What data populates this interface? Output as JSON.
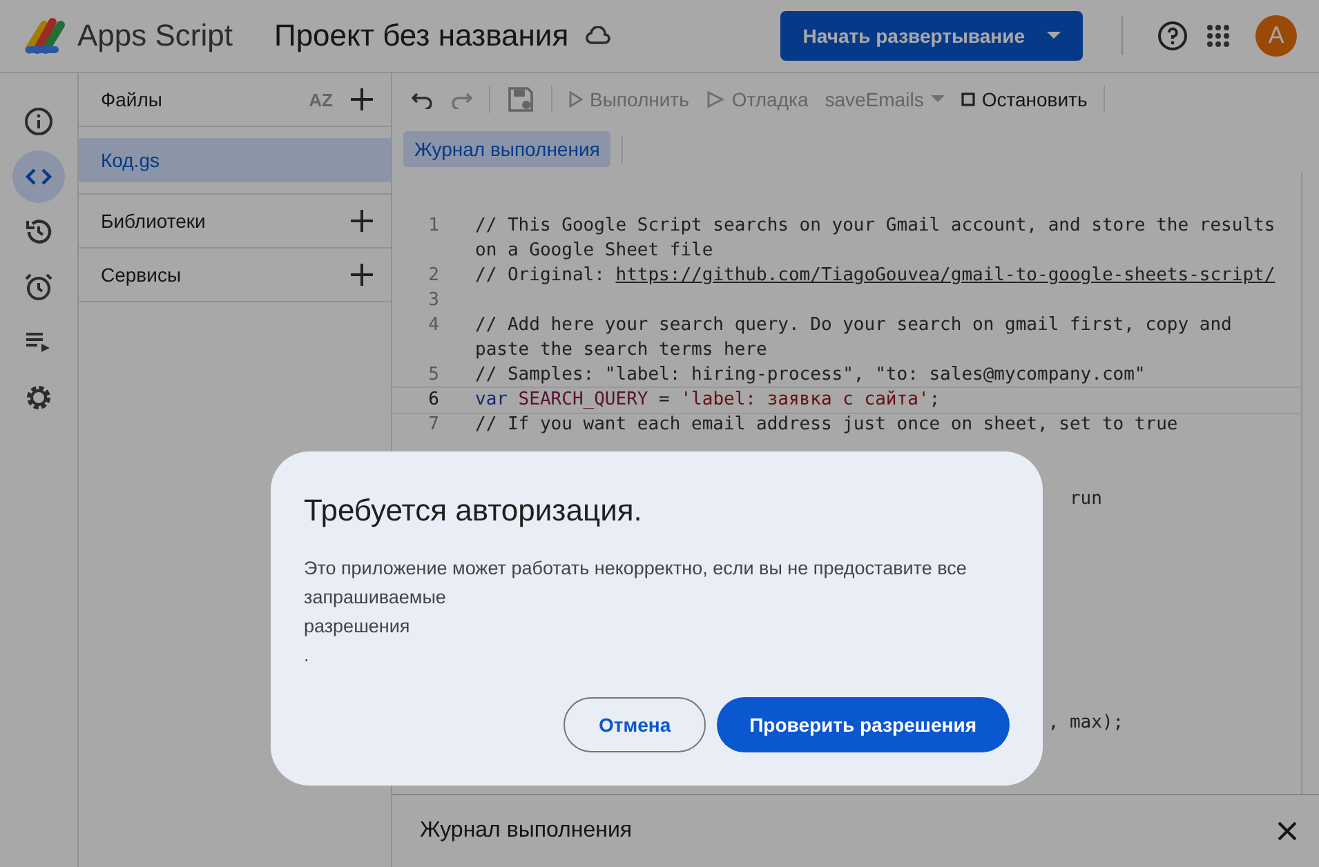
{
  "header": {
    "app_name": "Apps Script",
    "project_title": "Проект без названия",
    "deploy_button": "Начать развертывание",
    "avatar_letter": "A"
  },
  "rail": [
    {
      "selected": false
    },
    {
      "selected": true
    },
    {
      "selected": false
    },
    {
      "selected": false
    },
    {
      "selected": false
    },
    {
      "selected": false
    }
  ],
  "files_panel": {
    "sections": [
      {
        "title": "Файлы",
        "sort_label": "AZ",
        "items": [
          {
            "label": "Код.gs",
            "selected": true
          }
        ]
      },
      {
        "title": "Библиотеки"
      },
      {
        "title": "Сервисы"
      }
    ]
  },
  "toolbar": {
    "run": "Выполнить",
    "debug": "Отладка",
    "function": "saveEmails",
    "stop": "Остановить"
  },
  "tabs": [
    {
      "label": "Журнал выполнения",
      "selected": true
    }
  ],
  "code": [
    {
      "number": "1",
      "current": false,
      "segments": [
        {
          "kind": "comment",
          "text": "// This Google Script searchs on your Gmail account, and store the results on a Google Sheet file"
        }
      ]
    },
    {
      "number": "2",
      "current": false,
      "segments": [
        {
          "kind": "comment",
          "text": "// Original: "
        },
        {
          "kind": "link",
          "text": "https://github.com/TiagoGouvea/gmail-to-google-sheets-script/"
        }
      ]
    },
    {
      "number": "3",
      "current": false
    },
    {
      "number": "4",
      "current": false,
      "segments": [
        {
          "kind": "comment",
          "text": "// Add here your search query. Do your search on gmail first, copy and paste the search terms here"
        }
      ]
    },
    {
      "number": "5",
      "current": false,
      "segments": [
        {
          "kind": "comment",
          "text": "// Samples: \"label: hiring-process\", \"to: sales@mycompany.com\""
        }
      ]
    },
    {
      "number": "6",
      "current": true,
      "segments": [
        {
          "kind": "keyword",
          "text": "var"
        },
        {
          "kind": "variable",
          "text": " SEARCH_QUERY"
        },
        {
          "kind": "plain",
          "text": " = "
        },
        {
          "kind": "string",
          "text": "'label: заявка с сайта'"
        },
        {
          "kind": "plain",
          "text": ";"
        }
      ]
    },
    {
      "number": "7",
      "current": false,
      "segments": [
        {
          "kind": "comment",
          "text": "// If you want each email address just once on sheet, set to true"
        }
      ]
    }
  ],
  "code_fragments": [
    "run",
    ", max);"
  ],
  "log_panel": {
    "title": "Журнал выполнения"
  },
  "dialog": {
    "title": "Требуется авторизация.",
    "message": "Это приложение может работать некорректно, если вы не предоставите все\nзапрашиваемые\nразрешения\n.",
    "cancel": "Отмена",
    "confirm": "Проверить разрешения"
  }
}
